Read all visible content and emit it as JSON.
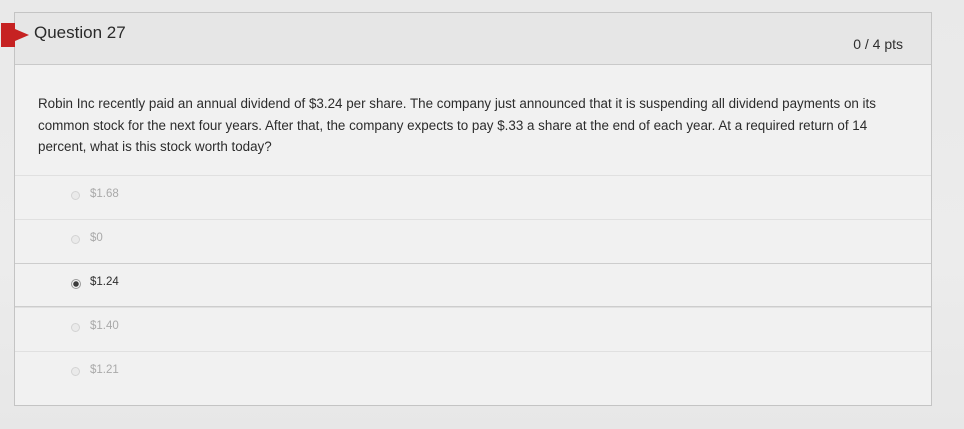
{
  "question": {
    "title": "Question 27",
    "points": "0 / 4 pts",
    "text": "Robin Inc recently paid an annual dividend of $3.24 per share. The company just announced that it is suspending all dividend payments on its common stock for the next four years. After that, the company expects to pay $.33 a share at the end of each year. At a required return of 14 percent, what is this stock worth today?"
  },
  "answers": [
    {
      "label": "$1.68",
      "selected": false
    },
    {
      "label": "$0",
      "selected": false
    },
    {
      "label": "$1.24",
      "selected": true
    },
    {
      "label": "$1.40",
      "selected": false
    },
    {
      "label": "$1.21",
      "selected": false
    }
  ],
  "colors": {
    "marker": "#c62222",
    "header_bg": "#e6e6e6",
    "card_bg": "#f1f1f1"
  }
}
